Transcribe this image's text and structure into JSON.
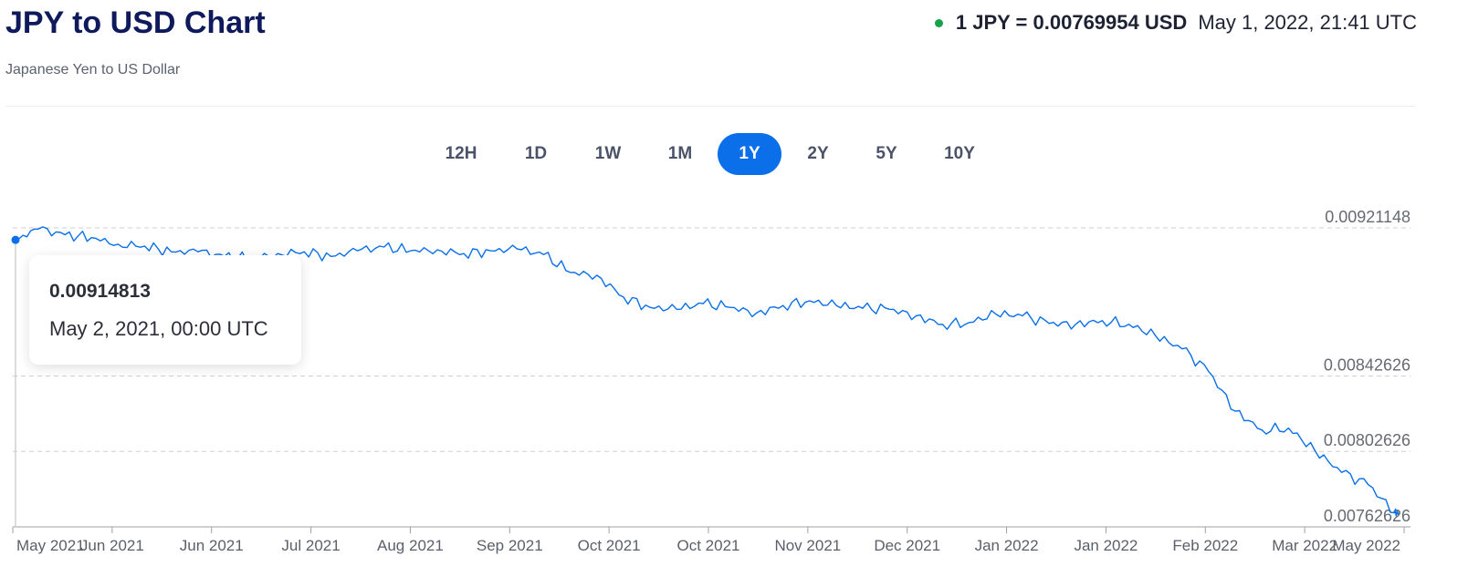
{
  "header": {
    "title": "JPY to USD Chart",
    "subtitle": "Japanese Yen to US Dollar",
    "rate_text": "1 JPY = 0.00769954 USD",
    "rate_time": "May 1, 2022, 21:41 UTC",
    "live_dot_color": "#16a34a"
  },
  "ranges": [
    {
      "label": "12H",
      "active": false
    },
    {
      "label": "1D",
      "active": false
    },
    {
      "label": "1W",
      "active": false
    },
    {
      "label": "1M",
      "active": false
    },
    {
      "label": "1Y",
      "active": true
    },
    {
      "label": "2Y",
      "active": false
    },
    {
      "label": "5Y",
      "active": false
    },
    {
      "label": "10Y",
      "active": false
    }
  ],
  "tooltip": {
    "value": "0.00914813",
    "date": "May 2, 2021, 00:00 UTC"
  },
  "chart_data": {
    "type": "line",
    "line_color": "#0a6fe8",
    "grid": true,
    "y_ticks": [
      "0.00921148",
      "0.00842626",
      "0.00802626",
      "0.00762626"
    ],
    "x_ticks": [
      "May 2021",
      "Jun 2021",
      "Jun 2021",
      "Jul 2021",
      "Aug 2021",
      "Sep 2021",
      "Oct 2021",
      "Oct 2021",
      "Nov 2021",
      "Dec 2021",
      "Jan 2022",
      "Jan 2022",
      "Feb 2022",
      "Mar 2022",
      "May 2022"
    ],
    "ylim": [
      0.00762626,
      0.00921148
    ],
    "series": [
      {
        "x": [
          "2021-05-02",
          "2021-05-08",
          "2021-05-15",
          "2021-05-22",
          "2021-05-29",
          "2021-06-05",
          "2021-06-12",
          "2021-06-19",
          "2021-06-26",
          "2021-07-03",
          "2021-07-10",
          "2021-07-17",
          "2021-07-24",
          "2021-07-31",
          "2021-08-07",
          "2021-08-14",
          "2021-08-21",
          "2021-08-28",
          "2021-09-04",
          "2021-09-11",
          "2021-09-18",
          "2021-09-25",
          "2021-10-02",
          "2021-10-09",
          "2021-10-16",
          "2021-10-23",
          "2021-10-30",
          "2021-11-06",
          "2021-11-13",
          "2021-11-20",
          "2021-11-27",
          "2021-12-04",
          "2021-12-11",
          "2021-12-18",
          "2021-12-25",
          "2022-01-01",
          "2022-01-08",
          "2022-01-15",
          "2022-01-22",
          "2022-01-29",
          "2022-02-05",
          "2022-02-12",
          "2022-02-19",
          "2022-02-26",
          "2022-03-05",
          "2022-03-12",
          "2022-03-19",
          "2022-03-26",
          "2022-04-02",
          "2022-04-09",
          "2022-04-16",
          "2022-04-23",
          "2022-04-30",
          "2022-05-01"
        ],
        "values": [
          0.009148,
          0.009205,
          0.009175,
          0.00916,
          0.009125,
          0.009115,
          0.009085,
          0.009085,
          0.00906,
          0.00905,
          0.009075,
          0.009085,
          0.00906,
          0.00909,
          0.00911,
          0.00909,
          0.009095,
          0.009075,
          0.00909,
          0.0091,
          0.00907,
          0.008975,
          0.00896,
          0.008845,
          0.00879,
          0.00878,
          0.00881,
          0.00879,
          0.00876,
          0.0088,
          0.008825,
          0.0088,
          0.008785,
          0.00878,
          0.008745,
          0.0087,
          0.00871,
          0.008755,
          0.008745,
          0.008705,
          0.0087,
          0.00872,
          0.0087,
          0.00864,
          0.00857,
          0.00845,
          0.00824,
          0.00814,
          0.00815,
          0.00803,
          0.007915,
          0.00785,
          0.0077,
          0.0077
        ]
      }
    ]
  }
}
